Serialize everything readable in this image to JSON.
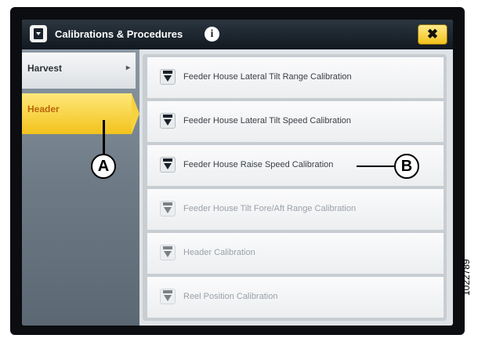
{
  "window": {
    "title": "Calibrations & Procedures",
    "close_label": "✖",
    "info_label": "i"
  },
  "sidebar": {
    "items": [
      {
        "label": "Harvest",
        "chevron": "▸",
        "state": "normal"
      },
      {
        "label": "Header",
        "state": "selected"
      }
    ]
  },
  "procedures": [
    {
      "label": "Feeder House Lateral Tilt Range Calibration",
      "enabled": true
    },
    {
      "label": "Feeder House Lateral Tilt Speed Calibration",
      "enabled": true
    },
    {
      "label": "Feeder House Raise Speed Calibration",
      "enabled": true
    },
    {
      "label": "Feeder House Tilt Fore/Aft Range Calibration",
      "enabled": false
    },
    {
      "label": "Header Calibration",
      "enabled": false
    },
    {
      "label": "Reel Position Calibration",
      "enabled": false
    }
  ],
  "callouts": {
    "a": "A",
    "b": "B"
  },
  "figure_number": "1022789",
  "colors": {
    "accent_yellow": "#f2c21c",
    "selected_text": "#b9660c",
    "titlebar": "#111820"
  },
  "icons": {
    "title": "calibration-clipboard-icon",
    "procedure": "cal-arrow-icon",
    "info": "info-icon",
    "close": "close-icon"
  }
}
